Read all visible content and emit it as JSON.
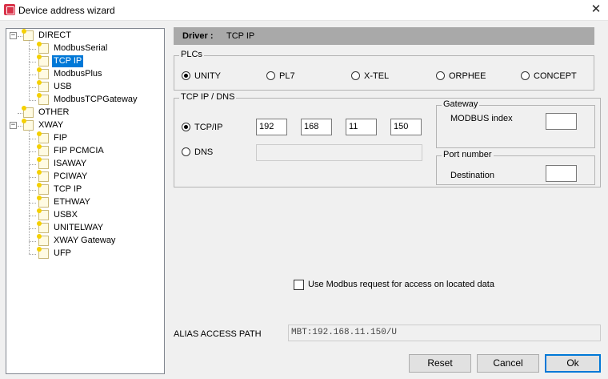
{
  "window": {
    "title": "Device address wizard",
    "close_glyph": "✕"
  },
  "tree": {
    "items": [
      {
        "label": "DIRECT",
        "level": 0,
        "expander": "−"
      },
      {
        "label": "ModbusSerial",
        "level": 1
      },
      {
        "label": "TCP IP",
        "level": 1,
        "selected": true
      },
      {
        "label": "ModbusPlus",
        "level": 1
      },
      {
        "label": "USB",
        "level": 1
      },
      {
        "label": "ModbusTCPGateway",
        "level": 1
      },
      {
        "label": "OTHER",
        "level": 0
      },
      {
        "label": "XWAY",
        "level": 0,
        "expander": "−"
      },
      {
        "label": "FIP",
        "level": 1
      },
      {
        "label": "FIP PCMCIA",
        "level": 1
      },
      {
        "label": "ISAWAY",
        "level": 1
      },
      {
        "label": "PCIWAY",
        "level": 1
      },
      {
        "label": "TCP IP",
        "level": 1
      },
      {
        "label": "ETHWAY",
        "level": 1
      },
      {
        "label": "USBX",
        "level": 1
      },
      {
        "label": "UNITELWAY",
        "level": 1
      },
      {
        "label": "XWAY Gateway",
        "level": 1
      },
      {
        "label": "UFP",
        "level": 1
      }
    ]
  },
  "driver": {
    "label": "Driver :",
    "value": "TCP IP"
  },
  "plcs": {
    "legend": "PLCs",
    "options": [
      {
        "label": "UNITY",
        "checked": true
      },
      {
        "label": "PL7",
        "checked": false
      },
      {
        "label": "X-TEL",
        "checked": false
      },
      {
        "label": "ORPHEE",
        "checked": false
      },
      {
        "label": "CONCEPT",
        "checked": false
      }
    ]
  },
  "tcpip": {
    "legend": "TCP IP / DNS",
    "tcp_label": "TCP/IP",
    "dns_label": "DNS",
    "tcp_checked": true,
    "ip": [
      "192",
      "168",
      "11",
      "150"
    ],
    "dns_value": ""
  },
  "gateway": {
    "legend": "Gateway",
    "modbus_label": "MODBUS index",
    "modbus_value": ""
  },
  "port": {
    "legend": "Port number",
    "dest_label": "Destination",
    "dest_value": ""
  },
  "modbus_check": {
    "label": "Use Modbus request for access on located data",
    "checked": false
  },
  "alias": {
    "label": "ALIAS ACCESS PATH",
    "value": "MBT:192.168.11.150/U"
  },
  "buttons": {
    "reset": "Reset",
    "cancel": "Cancel",
    "ok": "Ok"
  }
}
